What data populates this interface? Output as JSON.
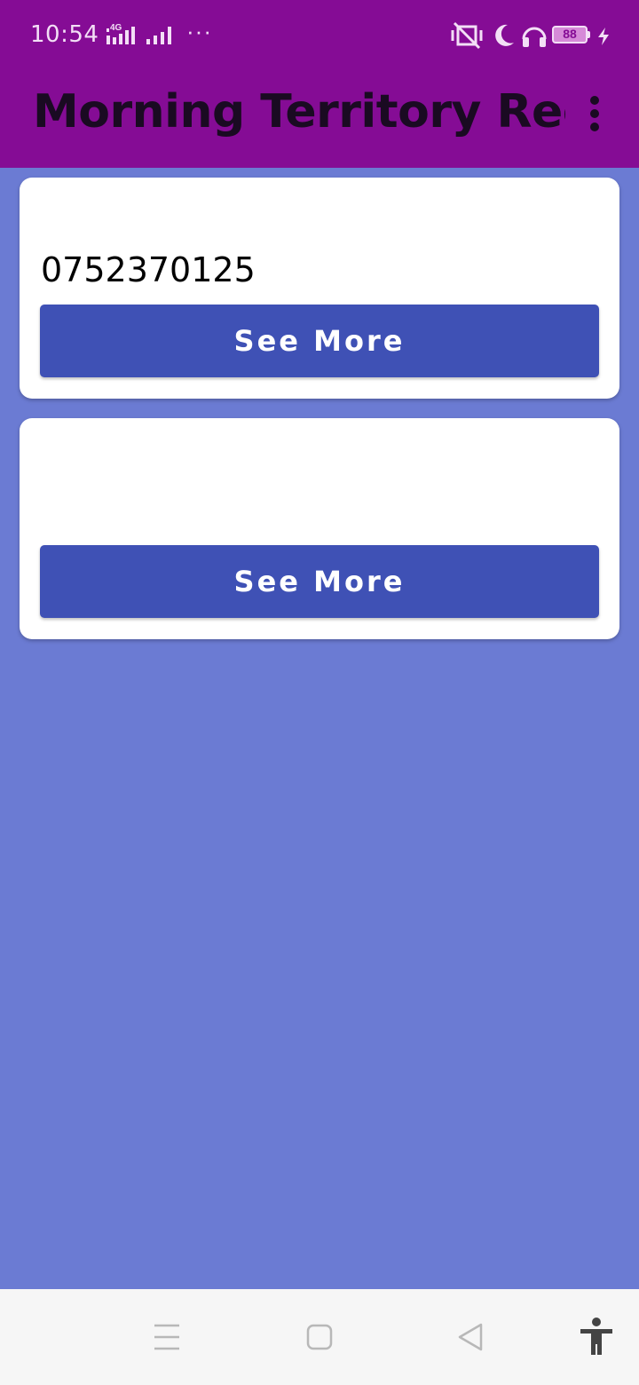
{
  "status_bar": {
    "time": "10:54",
    "network_label": "4G",
    "more_indicator": "···",
    "battery_level": "88",
    "icons": [
      "signal-4g-icon",
      "signal-icon",
      "vibrate-off-icon",
      "moon-icon",
      "headphones-icon",
      "battery-icon",
      "charging-bolt-icon"
    ]
  },
  "app_bar": {
    "title": "Morning Territory Rec…",
    "menu_icon": "more-vert-icon"
  },
  "cards": [
    {
      "phone": "0752370125",
      "button_label": "See More"
    },
    {
      "phone": "",
      "button_label": "See More"
    }
  ],
  "nav_bar": {
    "icons": [
      "recents-icon",
      "home-icon",
      "back-icon",
      "accessibility-icon"
    ]
  },
  "colors": {
    "header": "#850c95",
    "background": "#6b7bd3",
    "button": "#3f51b5",
    "card": "#ffffff"
  }
}
